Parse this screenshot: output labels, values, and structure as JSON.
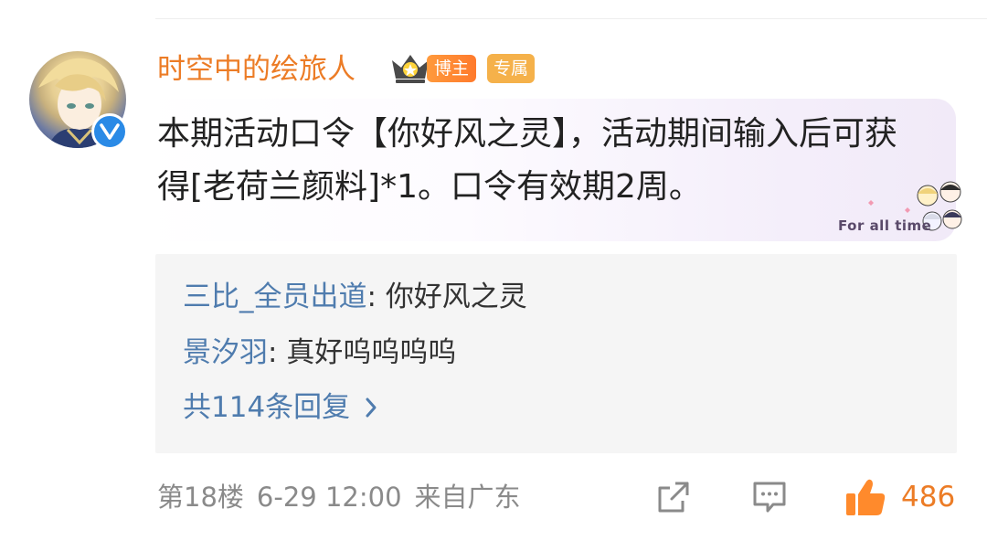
{
  "comment": {
    "username": "时空中的绘旅人",
    "badges": {
      "boss_label": "博主",
      "exclusive_label": "专属"
    },
    "content": "本期活动口令【你好风之灵】，活动期间输入后可获得[老荷兰颜料]*1。口令有效期2周。",
    "signature_text": "For all time"
  },
  "replies": [
    {
      "user": "三比_全员出道",
      "separator": ": ",
      "text": "你好风之灵"
    },
    {
      "user": "景汐羽",
      "separator": ": ",
      "text": "真好呜呜呜呜"
    }
  ],
  "reply_more": "共114条回复",
  "meta": {
    "floor": "第18楼",
    "datetime": "6-29 12:00",
    "location": "来自广东"
  },
  "actions": {
    "share_icon": "share-icon",
    "comment_icon": "comment-icon",
    "like_icon": "thumbs-up-icon",
    "like_count": "486"
  },
  "colors": {
    "username": "#ec7c26",
    "link": "#4f7cae",
    "like": "#ec7c26",
    "verified": "#2a8ae6"
  }
}
